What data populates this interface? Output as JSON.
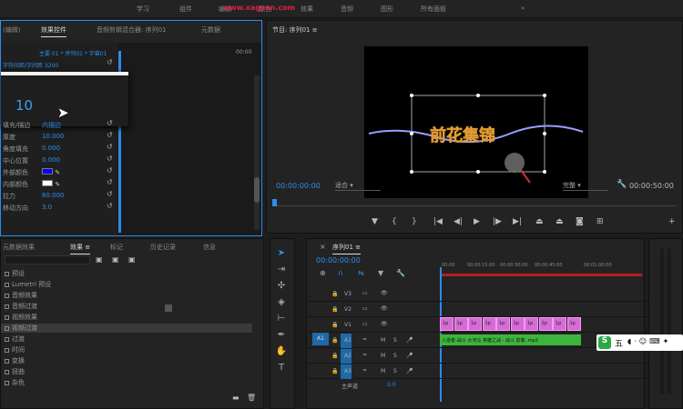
{
  "topbar": {
    "menu": [
      "学习",
      "组件",
      "编辑",
      "颜色",
      "效果",
      "音频",
      "图形",
      "所有面板",
      "»"
    ],
    "watermark": "www.xagyan.com"
  },
  "effect_controls": {
    "tabs": [
      "(编辑)",
      "效果控件",
      "音频剪辑混合器: 序列01",
      "元数据"
    ],
    "source_clip": "主要 01 * 序列01 * 字幕01",
    "time_start": "",
    "time_end": "00:00",
    "top_row": "字符间距/字间距  3200",
    "popup_value": "10",
    "rows": [
      {
        "label": "填充/描边",
        "value": "内描边"
      },
      {
        "label": "厚度",
        "value": "10.000"
      },
      {
        "label": "角度填充",
        "value": "0.000"
      },
      {
        "label": "中心位置",
        "value": "0.000"
      },
      {
        "label": "外部颜色",
        "value": ""
      },
      {
        "label": "内部颜色",
        "value": ""
      },
      {
        "label": "拉力",
        "value": "60.000"
      },
      {
        "label": "移动方向",
        "value": "3.0"
      }
    ],
    "colors": {
      "outer": "#0000ff",
      "inner": "#ffffff"
    }
  },
  "program": {
    "title": "节目: 序列01  ≡",
    "timecode": "00:00:00:00",
    "fit": "适合",
    "quality": "完整",
    "duration": "00:00:50:00",
    "title_text": "前花集锦"
  },
  "effects_panel": {
    "tabs": [
      "元数据效果",
      "效果 ≡",
      "标记",
      "历史记录",
      "信息"
    ],
    "items": [
      "预设",
      "Lumetri 预设",
      "音频效果",
      "音频过渡",
      "视频效果",
      "视频过渡",
      "过渡",
      "时间",
      "变换",
      "扭曲",
      "杂色"
    ],
    "selected_index": 5
  },
  "timeline": {
    "tab": "序列01 ≡",
    "timecode": "00:00:00:00",
    "ruler": [
      "00:00",
      "00:00:15:00",
      "00:00:30:00",
      "00:00:45:00",
      "00:01:00:00"
    ],
    "tracks": [
      {
        "name": "V3",
        "type": "video"
      },
      {
        "name": "V2",
        "type": "video"
      },
      {
        "name": "V1",
        "type": "video"
      },
      {
        "name": "A1",
        "type": "audio"
      },
      {
        "name": "A2",
        "type": "audio"
      },
      {
        "name": "A3",
        "type": "audio"
      }
    ],
    "master": "主声道",
    "master_value": "0.0",
    "video_clips": [
      "1p",
      "1p",
      "1p",
      "1p",
      "1p",
      "1p",
      "1p",
      "1p",
      "1p",
      "1p"
    ],
    "audio_clip": "入侵者-战斗 大河马 英雄之战 - 战斗 前奏 .mp3"
  },
  "ime": {
    "label": "五"
  }
}
